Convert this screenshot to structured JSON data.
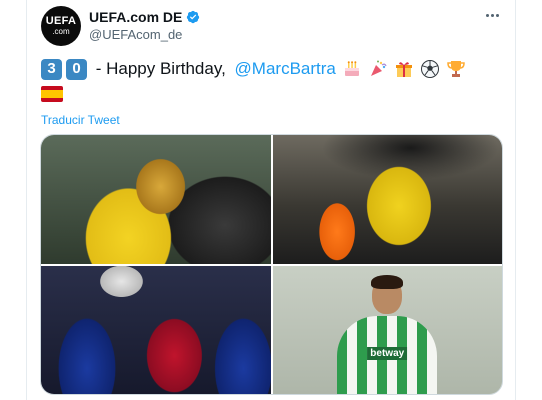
{
  "tweet": {
    "author": {
      "avatar_text_top": "UEFA",
      "avatar_text_bottom": ".com",
      "display_name": "UEFA.com DE",
      "handle": "@UEFAcom_de",
      "verified": true
    },
    "text": {
      "digit_1": "3",
      "digit_2": "0",
      "dash_text": " - Happy Birthday, ",
      "mention": "@MarcBartra",
      "emojis": [
        "cake-icon",
        "party-popper-icon",
        "gift-icon",
        "soccer-ball-icon",
        "trophy-icon",
        "spain-flag-icon"
      ]
    },
    "translate_label": "Traducir Tweet",
    "media": {
      "photos": [
        {
          "name": "photo-bartra-trophy-yellow"
        },
        {
          "name": "photo-bartra-celebration-flag"
        },
        {
          "name": "photo-bartra-champions-trophy"
        },
        {
          "name": "photo-bartra-betis-kit",
          "sponsor_text": "betway"
        }
      ]
    }
  },
  "colors": {
    "link_blue": "#1d9bf0",
    "keycap_blue": "#3b88c3",
    "text_primary": "#0f1419",
    "text_secondary": "#536471"
  }
}
